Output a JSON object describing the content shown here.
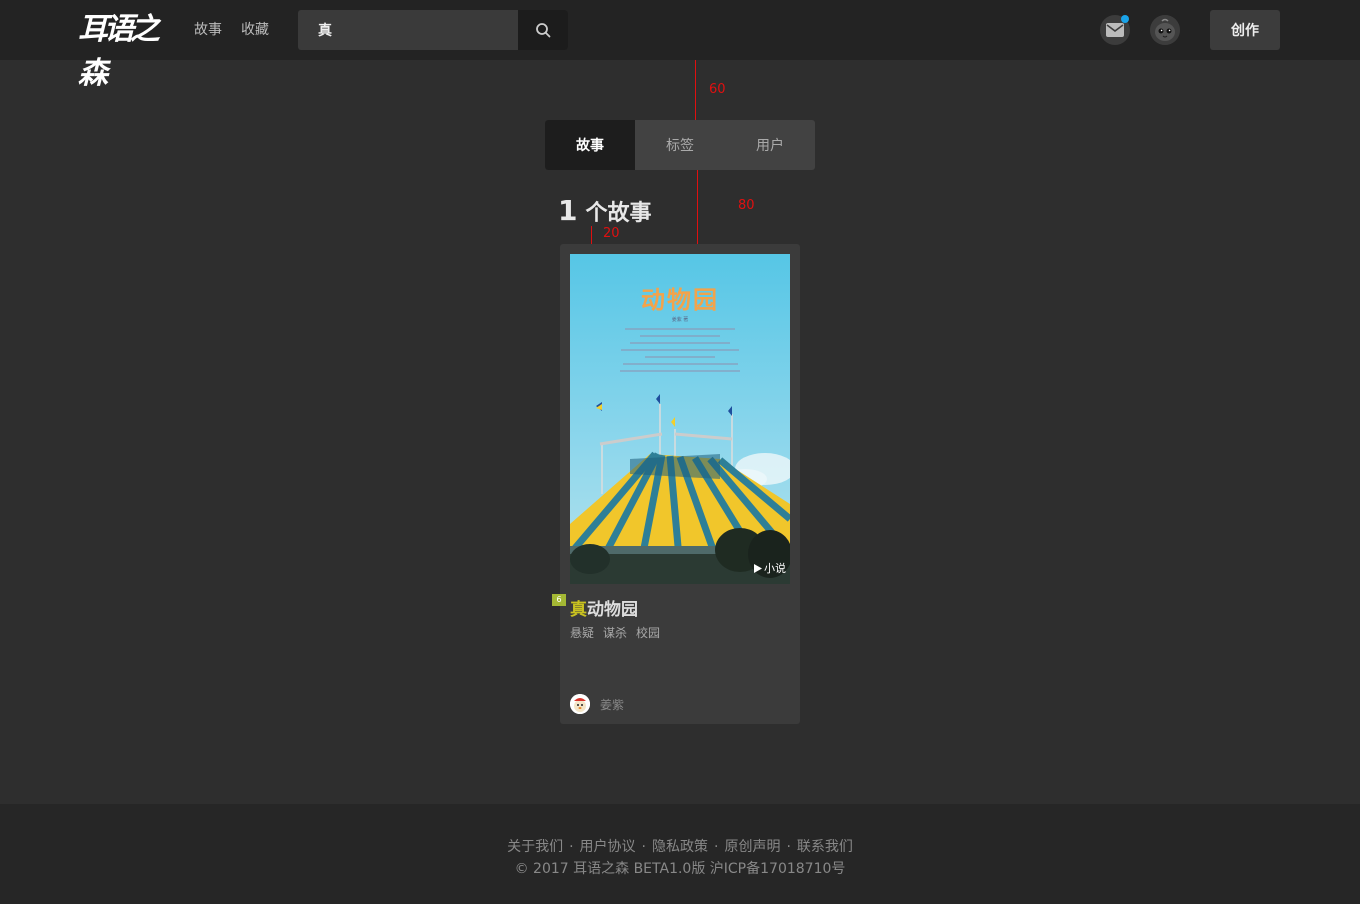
{
  "header": {
    "logo_text": "耳语之森",
    "nav": [
      {
        "label": "故事"
      },
      {
        "label": "收藏"
      }
    ],
    "search": {
      "value": "真",
      "icon": "search-icon"
    },
    "mail_icon": "mail-icon",
    "create_label": "创作"
  },
  "tabs": [
    {
      "label": "故事",
      "active": true
    },
    {
      "label": "标签",
      "active": false
    },
    {
      "label": "用户",
      "active": false
    }
  ],
  "results": {
    "count": "1",
    "count_label": "个故事"
  },
  "annotations": [
    "60",
    "80",
    "20"
  ],
  "story": {
    "cover": {
      "title": "动物园",
      "author": "姜紫 著"
    },
    "type_label": "小说",
    "level": "6",
    "title_highlight": "真",
    "title_rest": "动物园",
    "tags": [
      "悬疑",
      "谋杀",
      "校园"
    ],
    "author_name": "姜紫"
  },
  "footer": {
    "links": [
      "关于我们",
      "用户协议",
      "隐私政策",
      "原创声明",
      "联系我们"
    ],
    "separator": "·",
    "copyright": "© 2017 耳语之森 BETA1.0版 沪ICP备17018710号"
  },
  "colors": {
    "background": "#2e2e2e",
    "header": "#232323",
    "highlight": "#c9c220",
    "annotation": "#e01010",
    "notification": "#1aa3e8"
  }
}
